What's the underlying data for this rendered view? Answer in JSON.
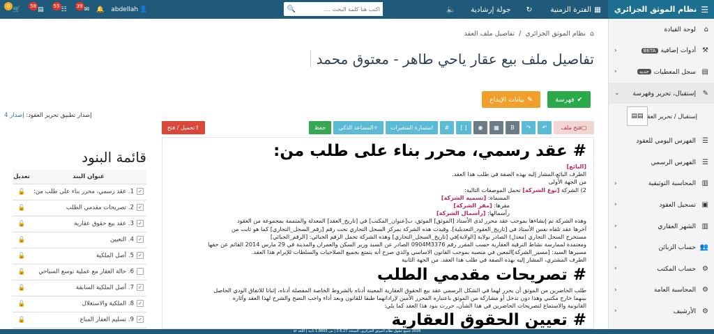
{
  "brand": {
    "title": "نظام الموثق الجزائري"
  },
  "topnav": {
    "search_placeholder": "اكتب هنا كلمة البحث ....",
    "guided_tour": "جولة إرشادية",
    "period": "الفترة الزمنية",
    "user": "abdellah",
    "badges": [
      "39",
      "55",
      "58",
      "0"
    ]
  },
  "sidebar": {
    "items": [
      {
        "label": "لوحة القيادة",
        "icon": "dashboard-icon",
        "chev": false
      },
      {
        "label": "أدوات إضافية",
        "tag": "BETA",
        "icon": "tools-icon",
        "chev": true
      },
      {
        "label": "سجل المعطيات",
        "tag": "جديد",
        "icon": "register-icon",
        "chev": true
      },
      {
        "label": "إستقبال، تحرير وفهرسة",
        "icon": "edit-icon",
        "chev": true,
        "active": true
      },
      {
        "label": "إستقبال / تحرير العقود",
        "sub": true
      },
      {
        "label": "الفهرس اليومي للعقود",
        "icon": "index-icon",
        "chev": false
      },
      {
        "label": "الفهرس الرسمي",
        "icon": "index-icon",
        "chev": false
      },
      {
        "label": "المحاسبة التوثيقية",
        "icon": "accounting-icon",
        "chev": true
      },
      {
        "label": "تسجيل العقود",
        "icon": "register-icon",
        "chev": true
      },
      {
        "label": "الشهر العقاري",
        "icon": "building-icon",
        "chev": true
      },
      {
        "label": "حساب الزبائن",
        "icon": "users-icon",
        "chev": true
      },
      {
        "label": "حساب المكتب",
        "icon": "office-icon",
        "chev": true
      },
      {
        "label": "المحاسبة العامة",
        "icon": "calc-icon",
        "chev": true
      },
      {
        "label": "الأرشيف",
        "icon": "archive-icon",
        "chev": true
      }
    ]
  },
  "breadcrumb": {
    "home": "نظام الموثق الجزائري",
    "current": "تفاصيل ملف العقد"
  },
  "page": {
    "title": "تفاصيل ملف بيع عقار ياحي طاهر - معتوق محمد"
  },
  "actions": {
    "index": "فهرسة",
    "deposit": "بيانات الإيداع"
  },
  "release": {
    "label": "إصدار تطبيق تحرير العقود:",
    "version": "إصدار 4"
  },
  "toolbar": {
    "open_file": "فتح ملف",
    "vars_form": "استمارة المتغيرات",
    "smart_assistant": "المساعد الذكي",
    "save": "حفظ",
    "upload_open": "تحميل / فتح",
    "bold": "B",
    "brackets": "[ ]",
    "hash": "#"
  },
  "editor": {
    "h1a": "# عقد رسمي، محرر بناء على طلب من:",
    "seller": "[البائع]",
    "l1": "الطرف البائع،المشار إليه بهذه الصفة في طلب هذا العقد.",
    "l2": "من الجهة الأولى",
    "l3a": "2) الشركة",
    "company_type": "[نوع الشركة]",
    "l3b": "تحمل الموصفات التالية:",
    "l4a": "المسماة:",
    "company_name": "[تسمية الشركة]",
    "l5a": "مقرها:",
    "company_hq": "[مقر الشركة]",
    "l6a": "رأسمالها:",
    "capital": "[رأسمال الشركة]",
    "l7": "وهذه الشركة تم إنشاءها بموجب عقد محرر لدى الأستاذ [الموثق] الموثق، ب[عنوان_المكتب] في [تاريخ_العقد] المعدلة والمتممة بمجموعة من العقود",
    "l8": "آخرها عقد تلقاه نفس الأستاذ في [تاريخ_العقود_التعديلية]. وقيدت هذه الشركة بمركز السجل التجاري تحت رقم [رقم_السجل_التجاري] كما هو ثابت من",
    "l9": "مستخرج السجل التجاري (معدل) الصادر بولاية [الولاية]في [تاريخ_السجل_التجاري] وهذه الشركة تحمل الرقم الجبائي: [الرقم_الجبائي]",
    "l10": "ومعتمدة لممارسة نشاط الترقية العقارية حسب المقرر رقم 0904M3376 الصادر عن السيد وزير السكن والعمران والمدينة في 29 مارس 2014 القائم عن حقها",
    "l11": "مسيرها السيد: [مسير_الشركة]المعين في منصبه بموجب القانون الاساسي والذي صرح أنه يتمتع بجميع الصلاحيات والسلطات للإبرام هذا العقد.",
    "l12": "الطرف المشتري، المشار إليه بهذه الصفة في طلب هذا العقد. من الجهة الثانية",
    "h1b": "# تصريحات مقدمي الطلب",
    "l13": "طلب الحاضرين من الموثق أن يحرر لهما في الشكل الرسمي عقد بيع الحقوق العقارية المعينة أدناه بالشروط الخاصة المفصلة أدناه، إثباتا للاتفاق الودي الحاصل",
    "l14": "بينهما خارج مكتبي وهذا دون تدخل أو مشاركة من الموثق باعتباره المحرر الأمين لإراداتهما طبقا للقانون وبعد أداء واجب النصح والشرح لهذا العقد وآثاره",
    "l15": "القانونية والاستماع لتصريحات الحاضرين في هذا الشأن، حررت بنود هذا العقد كما يلي:",
    "h1c": "# تعيين الحقوق العقارية"
  },
  "clauses": {
    "title": "قائمة البنود",
    "col_title": "عنوان البند",
    "col_edit": "تعديل",
    "items": [
      {
        "label": "1. عقد رسمي، محرر بناء على طلب من:",
        "checked": true
      },
      {
        "label": "2. تصريحات مقدمي الطلب",
        "checked": true
      },
      {
        "label": "3. عقد بيع حقوق عقارية",
        "checked": true
      },
      {
        "label": "4. التعيين",
        "checked": true
      },
      {
        "label": "5. أصل الملكية",
        "checked": true
      },
      {
        "label": "6. حالة العقار مع عملية توسع السياحي",
        "checked": false
      },
      {
        "label": "7. أصل الملكية السابقة",
        "checked": true
      },
      {
        "label": "8. الملكية والاستغلال",
        "checked": true
      },
      {
        "label": "9. تسليم العقار المباع",
        "checked": true
      }
    ]
  },
  "footer": {
    "text": "2026 جميع حقوق نظام الموثق الجزائري، النسخة 2.6.27 | من 1.8693 ثانية | اللغة ar"
  }
}
